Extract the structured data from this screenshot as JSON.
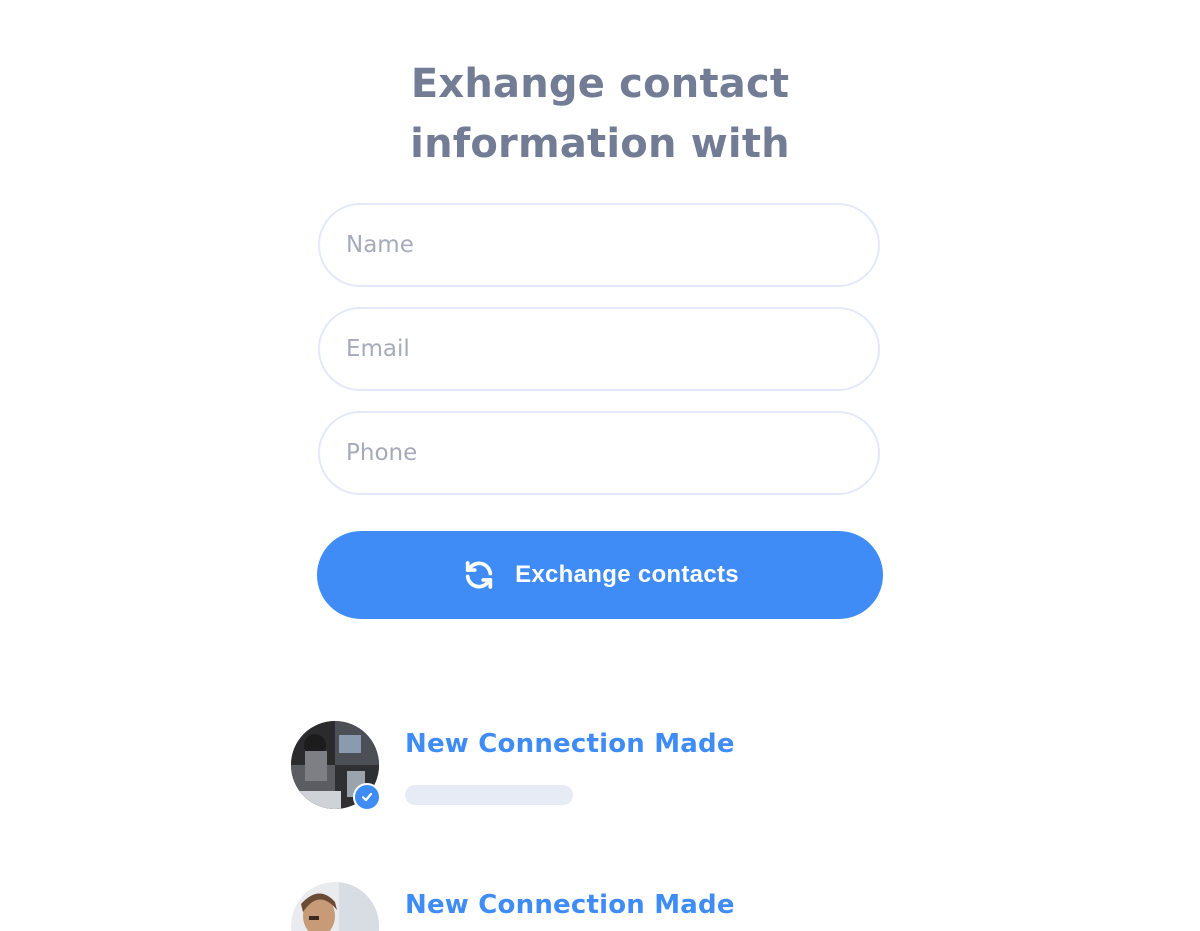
{
  "form": {
    "title_line1": "Exhange contact",
    "title_line2": "information with",
    "name_placeholder": "Name",
    "email_placeholder": "Email",
    "phone_placeholder": "Phone",
    "submit_label": "Exchange contacts",
    "submit_icon": "refresh-icon"
  },
  "connections": [
    {
      "title": "New Connection Made",
      "verified": true
    },
    {
      "title": "New Connection Made"
    }
  ],
  "colors": {
    "accent": "#3f8cf6",
    "title": "#737c95",
    "field_border": "#e3e9fb",
    "placeholder_bar": "#e6ebf5"
  }
}
